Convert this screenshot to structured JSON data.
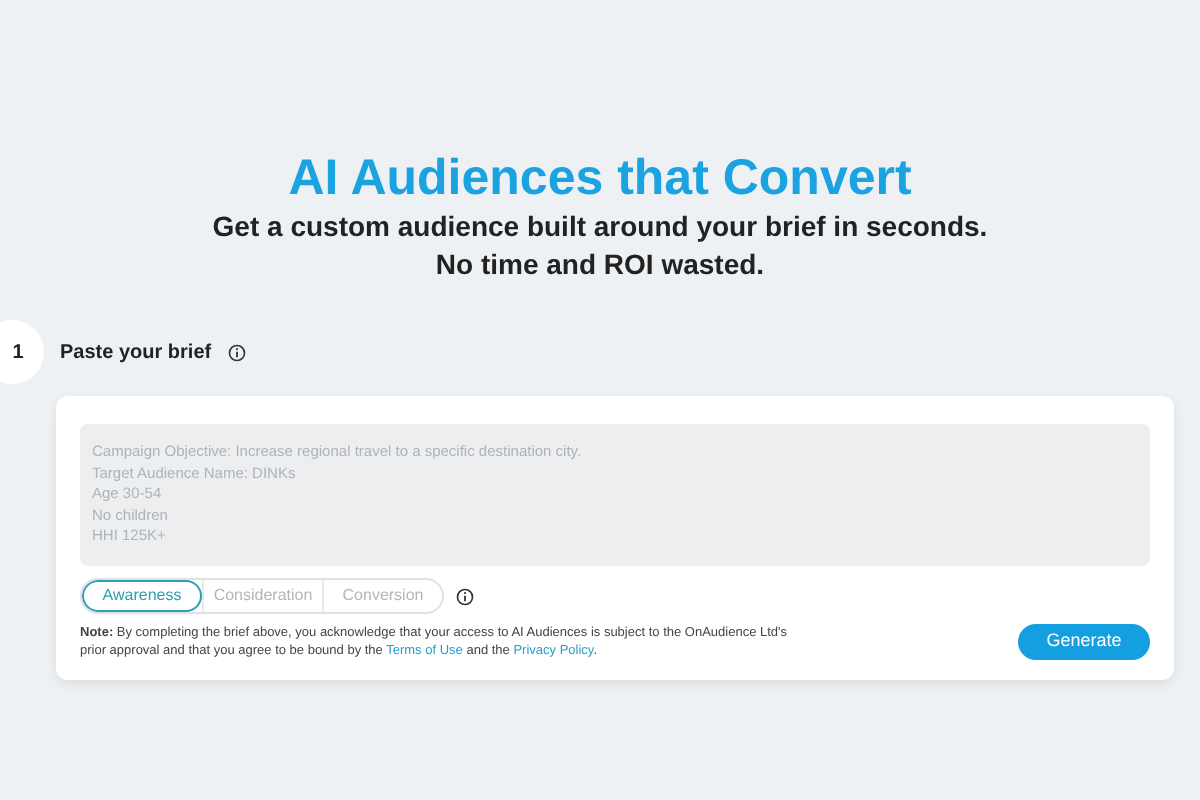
{
  "hero": {
    "title": "AI Audiences that Convert",
    "subtitle_lines": [
      "Get a custom audience built around your brief in seconds.",
      "No time and ROI wasted."
    ]
  },
  "step": {
    "number": "1",
    "label": "Paste your brief"
  },
  "brief": {
    "placeholder": "Campaign Objective: Increase regional travel to a specific destination city.\nTarget Audience Name: DINKs\nAge 30-54\nNo children\nHHI 125K+"
  },
  "tabs": [
    {
      "label": "Awareness",
      "selected": true
    },
    {
      "label": "Consideration",
      "selected": false
    },
    {
      "label": "Conversion",
      "selected": false
    }
  ],
  "note": {
    "label": "Note:",
    "parts": [
      {
        "kind": "text",
        "text": " By completing the brief above, you acknowledge that your access to AI Audiences is subject to the OnAudience Ltd's prior approval and that you agree to be bound by the "
      },
      {
        "kind": "link",
        "text": "Terms of Use"
      },
      {
        "kind": "text",
        "text": " and the "
      },
      {
        "kind": "link",
        "text": "Privacy Policy"
      },
      {
        "kind": "text",
        "text": "."
      }
    ]
  },
  "generate_button": "Generate"
}
